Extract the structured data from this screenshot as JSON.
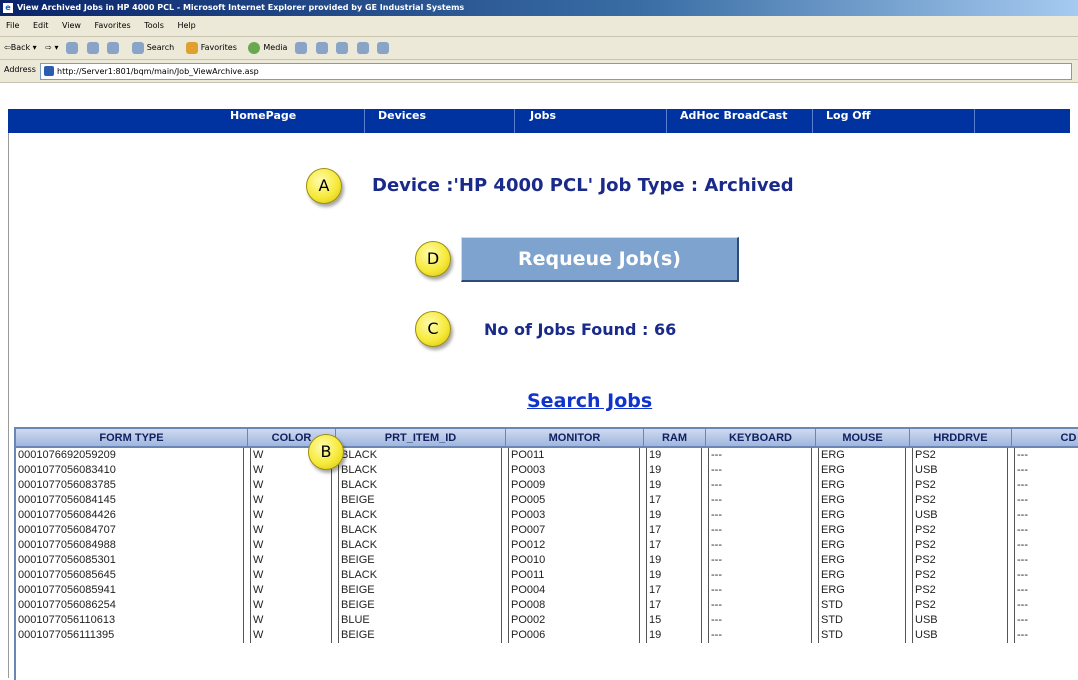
{
  "window": {
    "title": "View Archived Jobs in HP 4000 PCL - Microsoft Internet Explorer provided by GE Industrial Systems"
  },
  "menu": [
    "File",
    "Edit",
    "View",
    "Favorites",
    "Tools",
    "Help"
  ],
  "toolbar": {
    "back": "Back",
    "search": "Search",
    "favorites": "Favorites",
    "media": "Media"
  },
  "address": {
    "label": "Address",
    "url": "http://Server1:801/bqm/main/Job_ViewArchive.asp"
  },
  "nav": [
    "HomePage",
    "Devices",
    "Jobs",
    "AdHoc BroadCast",
    "Log Off"
  ],
  "markers": {
    "a": "A",
    "b": "B",
    "c": "C",
    "d": "D"
  },
  "device_heading": "Device :'HP 4000 PCL'   Job Type : Archived",
  "requeue_label": "Requeue Job(s)",
  "jobs_found": "No of Jobs Found : 66",
  "search_jobs": "Search Jobs",
  "table": {
    "columns": [
      "FORM TYPE",
      "COLOR",
      "PRT_ITEM_ID",
      "MONITOR",
      "RAM",
      "KEYBOARD",
      "MOUSE",
      "HRDDRVE",
      "CD"
    ],
    "rows": [
      [
        "0001076692059209",
        "W",
        "BLACK",
        "PO011",
        "19",
        "---",
        "ERG",
        "PS2",
        "---"
      ],
      [
        "0001077056083410",
        "W",
        "BLACK",
        "PO003",
        "19",
        "---",
        "ERG",
        "USB",
        "---"
      ],
      [
        "0001077056083785",
        "W",
        "BLACK",
        "PO009",
        "19",
        "---",
        "ERG",
        "PS2",
        "---"
      ],
      [
        "0001077056084145",
        "W",
        "BEIGE",
        "PO005",
        "17",
        "---",
        "ERG",
        "PS2",
        "---"
      ],
      [
        "0001077056084426",
        "W",
        "BLACK",
        "PO003",
        "19",
        "---",
        "ERG",
        "USB",
        "---"
      ],
      [
        "0001077056084707",
        "W",
        "BLACK",
        "PO007",
        "17",
        "---",
        "ERG",
        "PS2",
        "---"
      ],
      [
        "0001077056084988",
        "W",
        "BLACK",
        "PO012",
        "17",
        "---",
        "ERG",
        "PS2",
        "---"
      ],
      [
        "0001077056085301",
        "W",
        "BEIGE",
        "PO010",
        "19",
        "---",
        "ERG",
        "PS2",
        "---"
      ],
      [
        "0001077056085645",
        "W",
        "BLACK",
        "PO011",
        "19",
        "---",
        "ERG",
        "PS2",
        "---"
      ],
      [
        "0001077056085941",
        "W",
        "BEIGE",
        "PO004",
        "17",
        "---",
        "ERG",
        "PS2",
        "---"
      ],
      [
        "0001077056086254",
        "W",
        "BEIGE",
        "PO008",
        "17",
        "---",
        "STD",
        "PS2",
        "---"
      ],
      [
        "0001077056110613",
        "W",
        "BLUE",
        "PO002",
        "15",
        "---",
        "STD",
        "USB",
        "---"
      ],
      [
        "0001077056111395",
        "W",
        "BEIGE",
        "PO006",
        "19",
        "---",
        "STD",
        "USB",
        "---"
      ]
    ]
  }
}
